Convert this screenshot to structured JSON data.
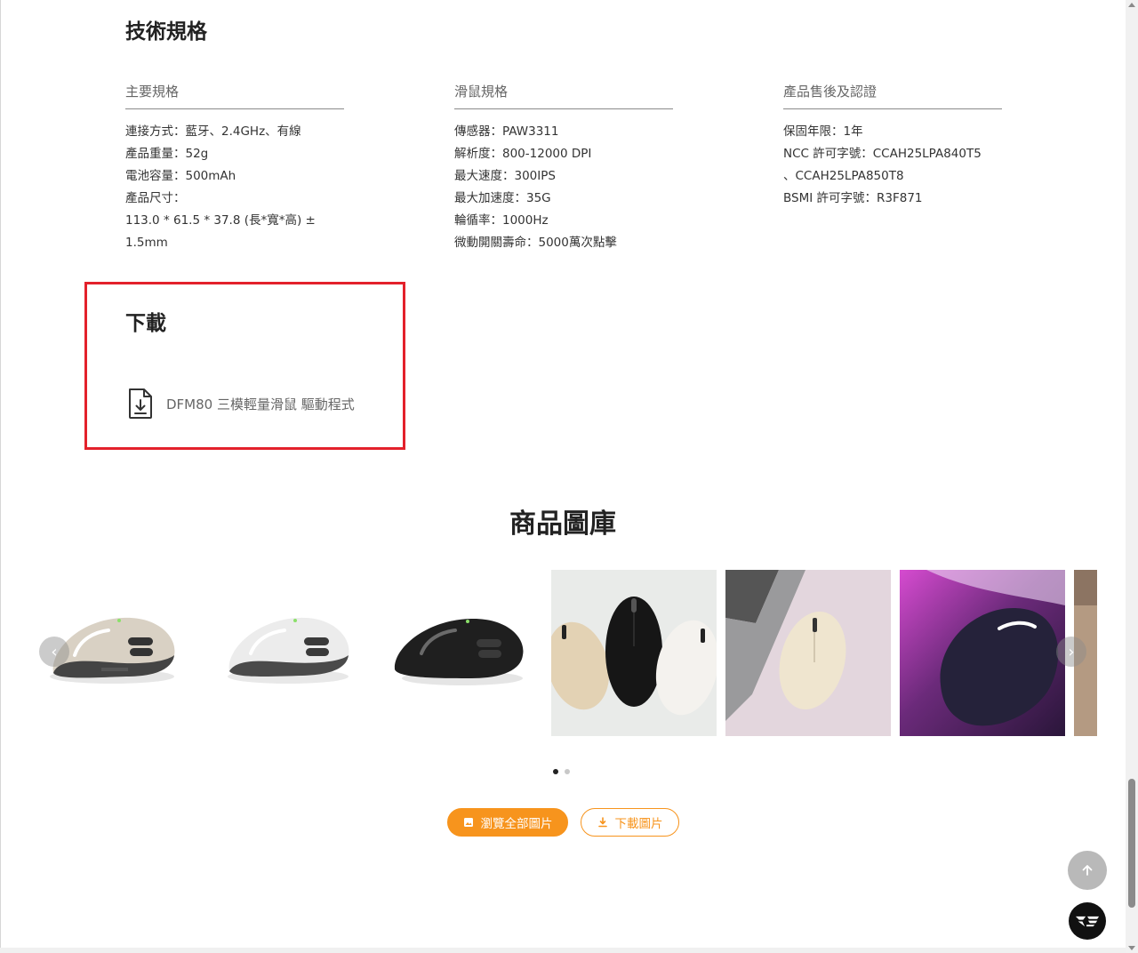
{
  "specs": {
    "title": "技術規格",
    "main": {
      "heading": "主要規格",
      "items": [
        "連接方式：藍牙、2.4GHz、有線",
        "產品重量：52g",
        "電池容量：500mAh",
        "產品尺寸：",
        "113.0 * 61.5 * 37.8 (長*寬*高) ± 1.5mm"
      ]
    },
    "mouse": {
      "heading": "滑鼠規格",
      "items": [
        "傳感器：PAW3311",
        "解析度：800-12000 DPI",
        "最大速度：300IPS",
        "最大加速度：35G",
        "輪循率：1000Hz",
        "微動開關壽命：5000萬次點擊"
      ]
    },
    "warranty": {
      "heading": "產品售後及認證",
      "items": [
        "保固年限：1年",
        "NCC 許可字號：CCAH25LPA840T5",
        "、CCAH25LPA850T8",
        "BSMI 許可字號：R3F871"
      ]
    }
  },
  "download": {
    "title": "下載",
    "icon": "file-download-icon",
    "label": "DFM80 三模輕量滑鼠 驅動程式"
  },
  "gallery": {
    "title": "商品圖庫",
    "prev_icon": "chevron-left-icon",
    "next_icon": "chevron-right-icon",
    "prev_symbol": "‹",
    "next_symbol": "›",
    "pages": 2,
    "active_page": 1,
    "browse_label": "瀏覽全部圖片",
    "download_label": "下載圖片"
  },
  "colors": {
    "accent": "#f7941d",
    "highlight": "#e3212b"
  }
}
